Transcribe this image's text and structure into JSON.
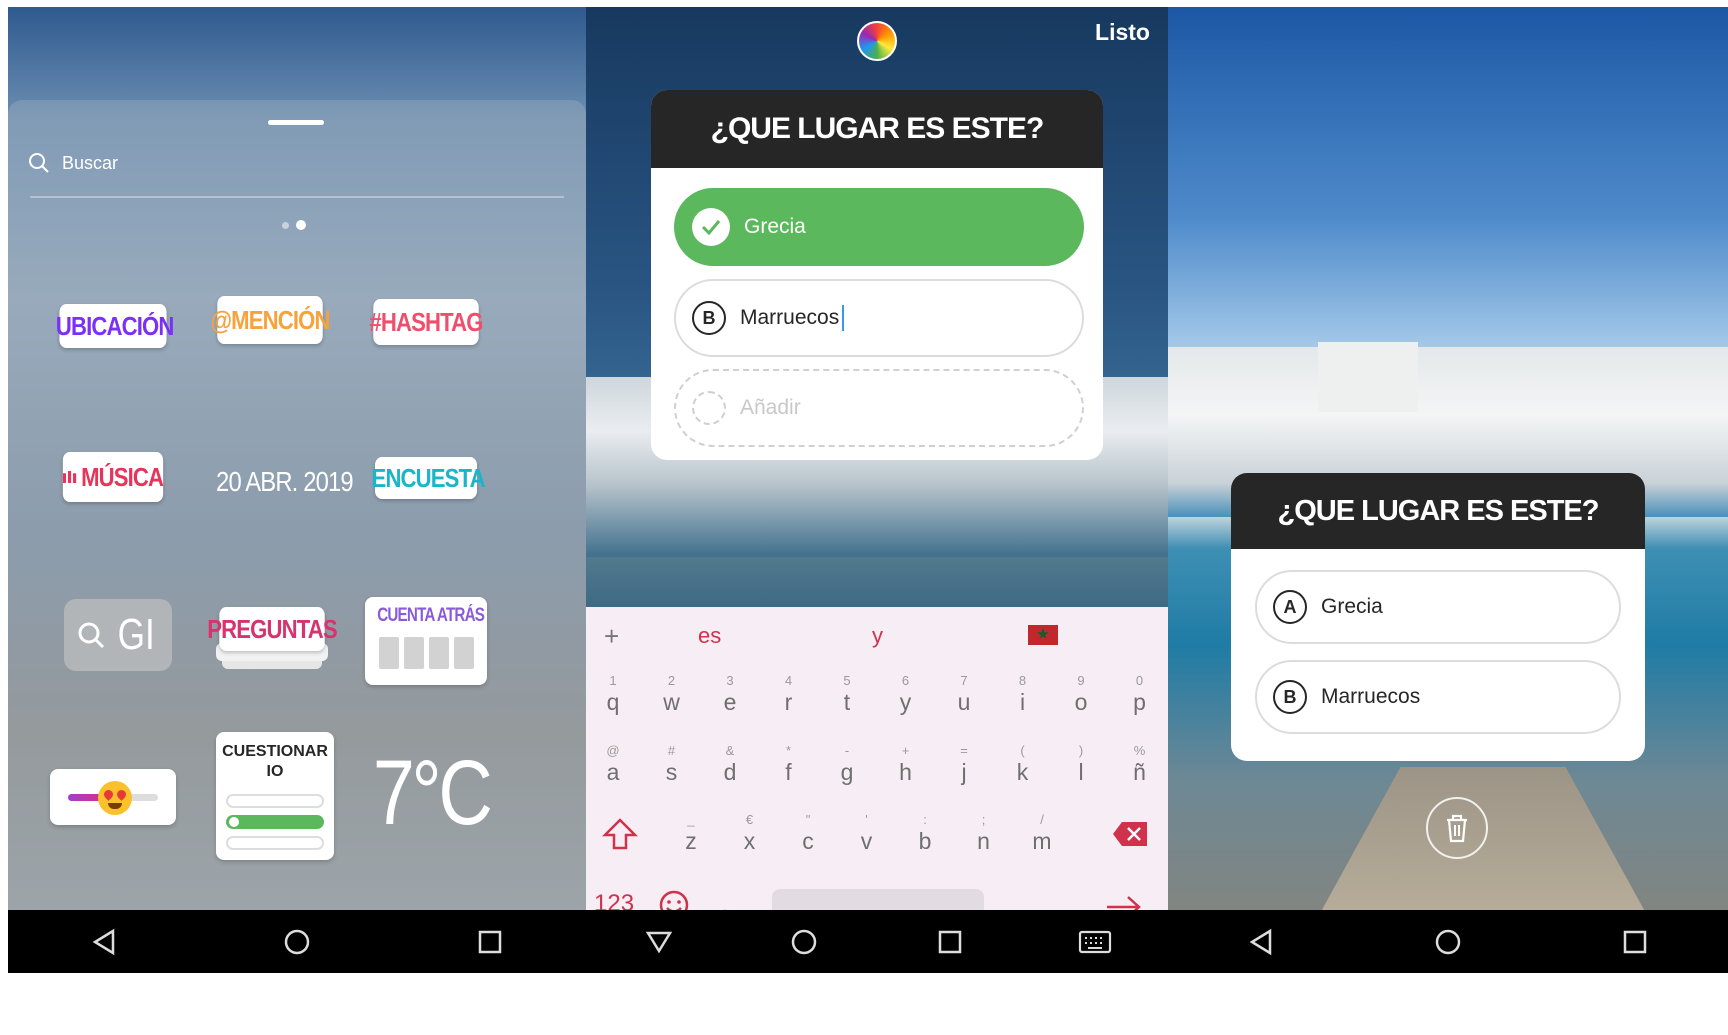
{
  "panel1": {
    "search_placeholder": "Buscar",
    "stickers": {
      "location": "UBICACIÓN",
      "mention": "@MENCIÓN",
      "hashtag": "#HASHTAG",
      "music": "MÚSICA",
      "date": "20 ABR. 2019",
      "poll": "ENCUESTA",
      "gif": "GI",
      "questions": "PREGUNTAS",
      "countdown": "CUENTA ATRÁS",
      "quiz": "CUESTIONARIO",
      "temperature": "7°C"
    }
  },
  "panel2": {
    "done_label": "Listo",
    "quiz_title": "¿QUE LUGAR ES ESTE?",
    "option_a": "Grecia",
    "option_b_letter": "B",
    "option_b": "Marruecos",
    "add_placeholder": "Añadir",
    "keyboard": {
      "plus": "+",
      "suggestions": [
        "es",
        "y"
      ],
      "row1": [
        [
          "1",
          "q"
        ],
        [
          "2",
          "w"
        ],
        [
          "3",
          "e"
        ],
        [
          "4",
          "r"
        ],
        [
          "5",
          "t"
        ],
        [
          "6",
          "y"
        ],
        [
          "7",
          "u"
        ],
        [
          "8",
          "i"
        ],
        [
          "9",
          "o"
        ],
        [
          "0",
          "p"
        ]
      ],
      "row2": [
        [
          "@",
          "a"
        ],
        [
          "#",
          "s"
        ],
        [
          "&",
          "d"
        ],
        [
          "*",
          "f"
        ],
        [
          "-",
          "g"
        ],
        [
          "+",
          "h"
        ],
        [
          "=",
          "j"
        ],
        [
          "(",
          "k"
        ],
        [
          ")",
          "l"
        ],
        [
          "%",
          "ñ"
        ]
      ],
      "row3": [
        [
          "_",
          "z"
        ],
        [
          "€",
          "x"
        ],
        [
          "\"",
          "c"
        ],
        [
          "'",
          "v"
        ],
        [
          ":",
          "b"
        ],
        [
          ";",
          "n"
        ],
        [
          "/",
          "m"
        ]
      ],
      "numbers_key": "123",
      "comma_key": ",",
      "period_key": "."
    }
  },
  "panel3": {
    "quiz_title": "¿QUE LUGAR ES ESTE?",
    "option_a_letter": "A",
    "option_a": "Grecia",
    "option_b_letter": "B",
    "option_b": "Marruecos"
  }
}
